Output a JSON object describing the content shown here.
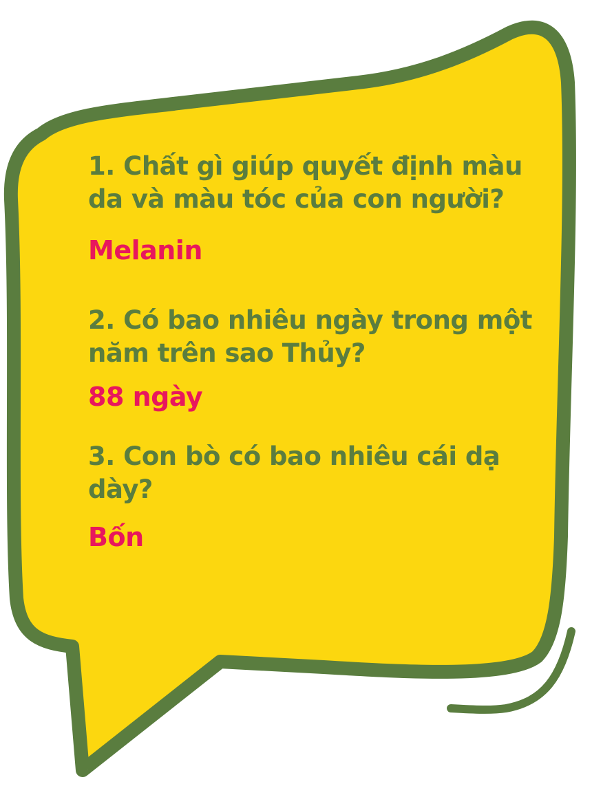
{
  "colors": {
    "bubble_fill": "#fcd70f",
    "bubble_outline": "#5a7d3f",
    "question_text": "#5a7d3f",
    "answer_text": "#e8175d"
  },
  "quiz": [
    {
      "question": "1. Chất gì giúp quyết định màu da và màu tóc của con người?",
      "answer": "Melanin"
    },
    {
      "question": "2. Có bao nhiêu ngày trong một năm trên sao Thủy?",
      "answer": "88 ngày"
    },
    {
      "question": "3. Con bò có bao nhiêu cái dạ dày?",
      "answer": "Bốn"
    }
  ]
}
